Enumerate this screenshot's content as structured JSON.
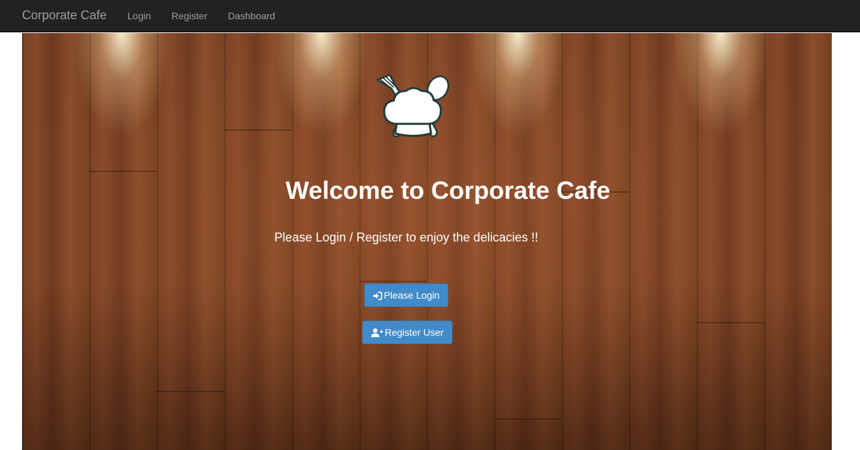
{
  "navbar": {
    "brand": "Corporate Cafe",
    "links": [
      {
        "label": "Login"
      },
      {
        "label": "Register"
      },
      {
        "label": "Dashboard"
      }
    ]
  },
  "hero": {
    "logo_icon": "chef-hat-utensils-icon",
    "title": "Welcome to Corporate Cafe",
    "subtitle": "Please Login / Register to enjoy the delicacies !!",
    "buttons": {
      "login_label": "Please Login",
      "login_icon": "sign-in-icon",
      "register_label": "Register User",
      "register_icon": "user-plus-icon"
    }
  },
  "colors": {
    "navbar_bg": "#222222",
    "navbar_text": "#9d9d9d",
    "button_primary": "#428bca",
    "hero_text": "#ffffff",
    "logo_outline": "#1f3d3a"
  }
}
